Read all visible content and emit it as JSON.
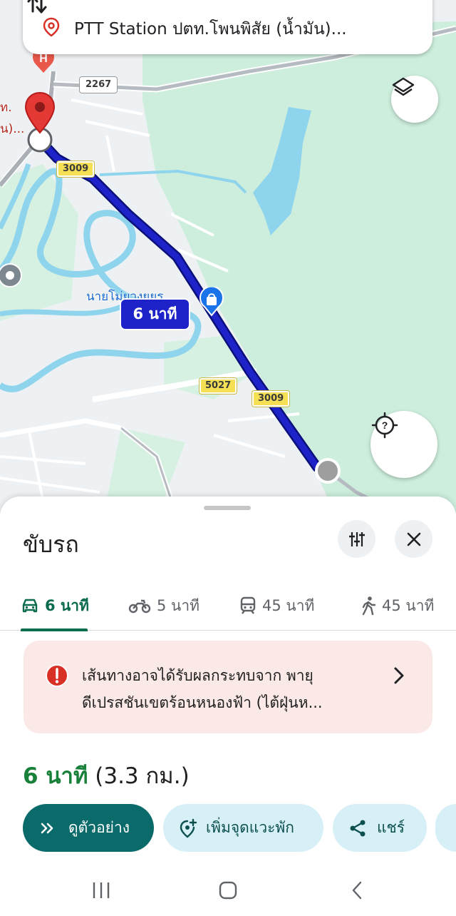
{
  "search": {
    "destination_text": "PTT Station ปตท.โพนพิสัย (น้ำมัน)..."
  },
  "map": {
    "origin_label_line1": "ท.",
    "origin_label_line2": "น)...",
    "poi_label": "นายโม่ยวงยยร",
    "eta_bubble": "6 นาที",
    "road_shields": [
      {
        "label": "2267",
        "style": "white"
      },
      {
        "label": "3009",
        "style": "yellow"
      },
      {
        "label": "3009",
        "style": "yellow"
      },
      {
        "label": "5027",
        "style": "yellow"
      }
    ],
    "route_color": "#1d23c8"
  },
  "sheet": {
    "title": "ขับรถ",
    "tabs": [
      {
        "mode": "drive",
        "icon": "car-icon",
        "label": "6 นาที",
        "selected": true
      },
      {
        "mode": "motorcycle",
        "icon": "motorcycle-icon",
        "label": "5 นาที",
        "selected": false
      },
      {
        "mode": "transit",
        "icon": "train-icon",
        "label": "45 นาที",
        "selected": false
      },
      {
        "mode": "walk",
        "icon": "walk-icon",
        "label": "45 นาที",
        "selected": false
      }
    ],
    "alert": {
      "line1": "เส้นทางอาจได้รับผลกระทบจาก พายุ",
      "line2": "ดีเปรสชันเขตร้อนหนองฟ้า (ไต้ฝุ่นห..."
    },
    "summary": {
      "time": "6 นาที",
      "distance": "(3.3 กม.)"
    },
    "actions": {
      "preview": "ดูตัวอย่าง",
      "add_stop": "เพิ่มจุดแวะพัก",
      "share": "แชร์"
    }
  },
  "colors": {
    "accent_green": "#0b6b4f",
    "time_green": "#188038",
    "alert_bg": "#fbe9e7",
    "alert_red": "#d93025",
    "chip_bg": "#d7f0f7",
    "primary_btn": "#0b6b6b"
  }
}
